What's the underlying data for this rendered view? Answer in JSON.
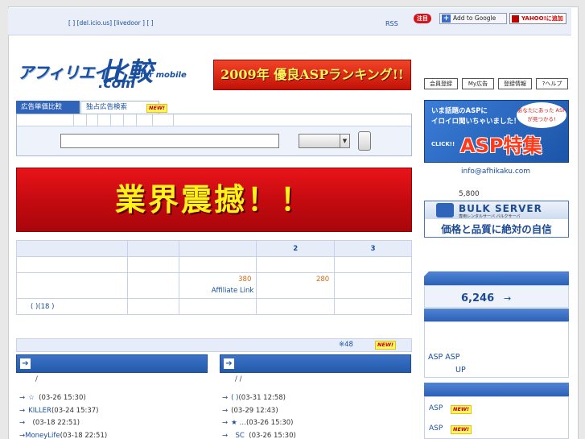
{
  "header": {
    "links": "[  ] [del.icio.us] [livedoor   ] [    ]",
    "rss": "RSS",
    "notice_badge": "注目",
    "google_button": "Add to Google",
    "yahoo_button": "YAHOO!に追加"
  },
  "logo": {
    "jp": "アフィリエイト",
    "big": "比較",
    "com": ".com",
    "mobile": "for mobile"
  },
  "banner_ranking": "2009年 優良ASPランキング!!",
  "tabs": [
    {
      "label": "広告単価比較"
    },
    {
      "label": "独占広告検索"
    }
  ],
  "new_label": "NEW!",
  "search": {
    "input_value": "",
    "select_value": ""
  },
  "banner_shock": "業界震撼！！",
  "rank_table": {
    "headers": [
      "",
      "",
      "",
      "2",
      "3"
    ],
    "row_price": {
      "v1": "380",
      "link": "Affiliate Link",
      "v2": "280"
    }
  },
  "recent_line": "(   )(18        )",
  "strip_note": "※48",
  "columns": [
    {
      "subline": "/",
      "items": [
        {
          "title": "☆",
          "date": "(03-26 15:30)"
        },
        {
          "title": "KILLER",
          "date": "(03-24 15:37)"
        },
        {
          "title": "",
          "date": "(03-18 22:51)"
        },
        {
          "title": "MoneyLife",
          "date": "(03-18 22:51)"
        }
      ]
    },
    {
      "subline": "/    /",
      "items": [
        {
          "title": "(    )",
          "date": "(03-31 12:58)"
        },
        {
          "title": "",
          "date": "(03-29 12:43)"
        },
        {
          "title": "★ …",
          "date": "(03-26 15:30)"
        },
        {
          "title": "SC",
          "date": "(03-26 15:30)"
        }
      ]
    }
  ],
  "right": {
    "menu": [
      "会員登録",
      "My広告",
      "登録情報",
      "?ヘルプ"
    ],
    "asp_banner": {
      "line1": "いま話題のASPに",
      "line2": "イロイロ聞いちゃいました！",
      "bubble": "あなたにあった ASPが見つかる!",
      "click": "CLICK!!",
      "big": "ASP特集"
    },
    "email": "info@afhikaku.com",
    "count_small": "5,800",
    "bulk": {
      "name": "BULK SERVER",
      "sub": "専用レンタルサーバ バルクサーバ",
      "tagline": "価格と品質に絶対の自信"
    },
    "big_count": "6,246",
    "big_count_arrow": "→",
    "asp_line1": "ASP     ASP",
    "asp_line2": "UP",
    "asp_new1": "ASP",
    "asp_new2": "ASP"
  }
}
